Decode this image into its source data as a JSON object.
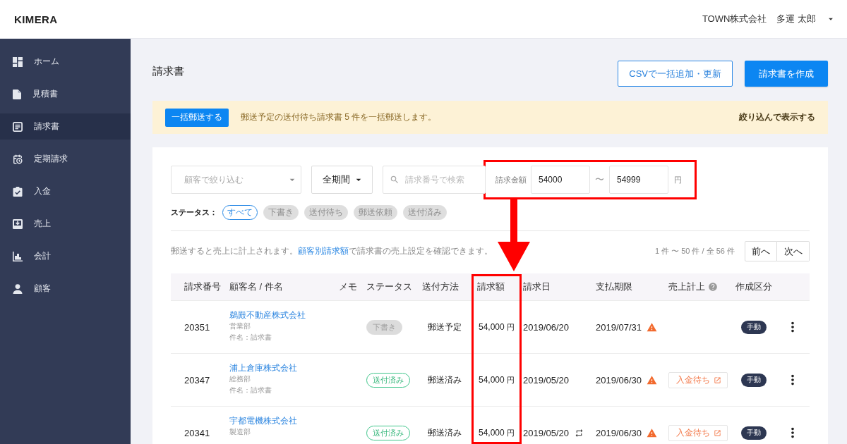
{
  "header": {
    "logo": "KIMERA",
    "company": "TOWN株式会社",
    "user": "多運 太郎"
  },
  "sidebar": {
    "items": [
      {
        "label": "ホーム",
        "selected": false
      },
      {
        "label": "見積書",
        "selected": false
      },
      {
        "label": "請求書",
        "selected": true
      },
      {
        "label": "定期請求",
        "selected": false
      },
      {
        "label": "入金",
        "selected": false
      },
      {
        "label": "売上",
        "selected": false
      },
      {
        "label": "会計",
        "selected": false
      },
      {
        "label": "顧客",
        "selected": false
      }
    ]
  },
  "page": {
    "title": "請求書",
    "buttons": [
      {
        "label": "CSVで一括追加・更新",
        "kind": "outline"
      },
      {
        "label": "請求書を作成",
        "kind": "primary"
      }
    ]
  },
  "notice": {
    "button": "一括郵送する",
    "message": "郵送予定の送付待ち請求書 5 件を一括郵送します。",
    "link": "絞り込んで表示する"
  },
  "filters": {
    "customer": {
      "placeholder": "顧客で絞り込む"
    },
    "period": "全期間",
    "search": {
      "placeholder": "請求番号で検索"
    },
    "amount": {
      "label": "請求金額",
      "min": "54000",
      "separator": "〜",
      "max": "54999",
      "unit": "円",
      "highlighted": true
    }
  },
  "status_filter": {
    "label": "ステータス：",
    "chips": [
      {
        "label": "すべて",
        "selected": true
      },
      {
        "label": "下書き",
        "selected": false
      },
      {
        "label": "送付待ち",
        "selected": false
      },
      {
        "label": "郵送依頼",
        "selected": false
      },
      {
        "label": "送付済み",
        "selected": false
      }
    ]
  },
  "info": {
    "text": "郵送すると売上に計上されます。",
    "link": "顧客別請求額",
    "text_after": "で請求書の売上設定を確認できます。"
  },
  "pagination": {
    "range": "1 件 〜 50 件 / 全 56 件",
    "buttons": [
      "前へ",
      "次へ"
    ]
  },
  "annotations": {
    "arrow": true
  },
  "table": {
    "amount_column_highlighted": true,
    "columns": [
      {
        "label": "請求番号",
        "help": false
      },
      {
        "label": "顧客名 / 件名",
        "help": false
      },
      {
        "label": "メモ",
        "help": false
      },
      {
        "label": "ステータス",
        "help": false
      },
      {
        "label": "送付方法",
        "help": false
      },
      {
        "label": "請求額",
        "help": false
      },
      {
        "label": "請求日",
        "help": false
      },
      {
        "label": "支払期限",
        "help": false
      },
      {
        "label": "売上計上",
        "help": true
      },
      {
        "label": "作成区分",
        "help": false
      }
    ],
    "rows": [
      {
        "number": "20351",
        "customer": "鵜殿不動産株式会社",
        "department": "営業部",
        "subject": "件名：請求書",
        "status": {
          "label": "下書き",
          "kind": "draft"
        },
        "method": "郵送予定",
        "amount": "54,000",
        "currency": "円",
        "issue_date": "2019/06/20",
        "recurring": false,
        "due_date": "2019/07/31",
        "overdue": true,
        "created_by": "手動"
      },
      {
        "number": "20347",
        "customer": "浦上倉庫株式会社",
        "department": "総務部",
        "subject": "件名：請求書",
        "status": {
          "label": "送付済み",
          "kind": "sent"
        },
        "method": "郵送済み",
        "amount": "54,000",
        "currency": "円",
        "issue_date": "2019/05/20",
        "recurring": false,
        "due_date": "2019/06/30",
        "overdue": true,
        "sales": "入金待ち",
        "created_by": "手動"
      },
      {
        "number": "20341",
        "customer": "宇都電機株式会社",
        "department": "製造部",
        "status": {
          "label": "送付済み",
          "kind": "sent"
        },
        "method": "郵送済み",
        "amount": "54,000",
        "currency": "円",
        "issue_date": "2019/05/20",
        "recurring": true,
        "due_date": "2019/06/30",
        "overdue": true,
        "sales": "入金待ち",
        "created_by": "手動"
      }
    ]
  }
}
